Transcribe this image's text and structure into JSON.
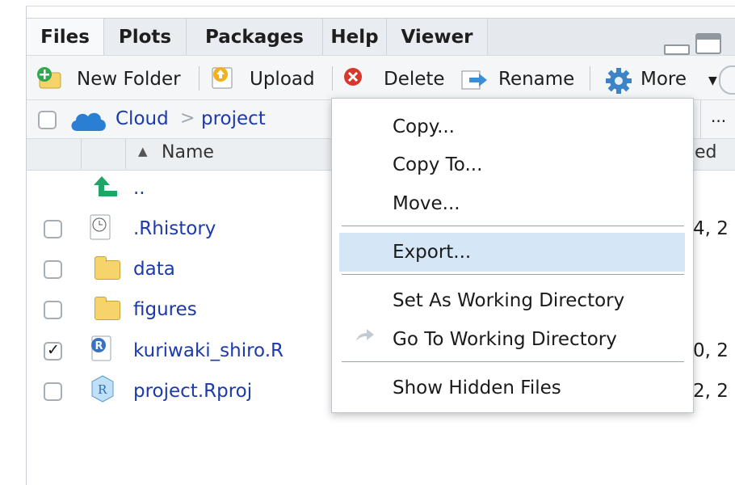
{
  "tabs": [
    "Files",
    "Plots",
    "Packages",
    "Help",
    "Viewer"
  ],
  "toolbar": {
    "new_folder": "New Folder",
    "upload": "Upload",
    "delete": "Delete",
    "rename": "Rename",
    "more": "More"
  },
  "breadcrumb": {
    "root": "Cloud",
    "separator": ">",
    "folder": "project",
    "overflow": "..."
  },
  "columns": {
    "name": "Name",
    "modified_partial": "ed"
  },
  "files": {
    "parent": "..",
    "rows": [
      {
        "name": ".Rhistory",
        "modified_partial": "4, 2",
        "checked": false
      },
      {
        "name": "data",
        "modified_partial": "",
        "checked": false
      },
      {
        "name": "figures",
        "modified_partial": "",
        "checked": false
      },
      {
        "name": "kuriwaki_shiro.R",
        "modified_partial": "0, 2",
        "checked": true
      },
      {
        "name": "project.Rproj",
        "modified_partial": "2, 2",
        "checked": false
      }
    ]
  },
  "menu": {
    "copy": "Copy...",
    "copy_to": "Copy To...",
    "move": "Move...",
    "export": "Export...",
    "set_wd": "Set As Working Directory",
    "go_wd": "Go To Working Directory",
    "show_hidden": "Show Hidden Files",
    "highlighted": "Export..."
  },
  "colors": {
    "accent_link": "#1c3aa9",
    "menu_highlight": "#d5e6f6",
    "folder": "#f6d36b",
    "cloud": "#2a7fd4"
  },
  "icons": [
    "new-folder-icon",
    "upload-icon",
    "delete-icon",
    "rename-icon",
    "gear-icon",
    "cloud-icon",
    "up-arrow-icon",
    "history-icon",
    "folder-icon",
    "r-script-icon",
    "rproj-icon",
    "forward-arrow-icon"
  ]
}
